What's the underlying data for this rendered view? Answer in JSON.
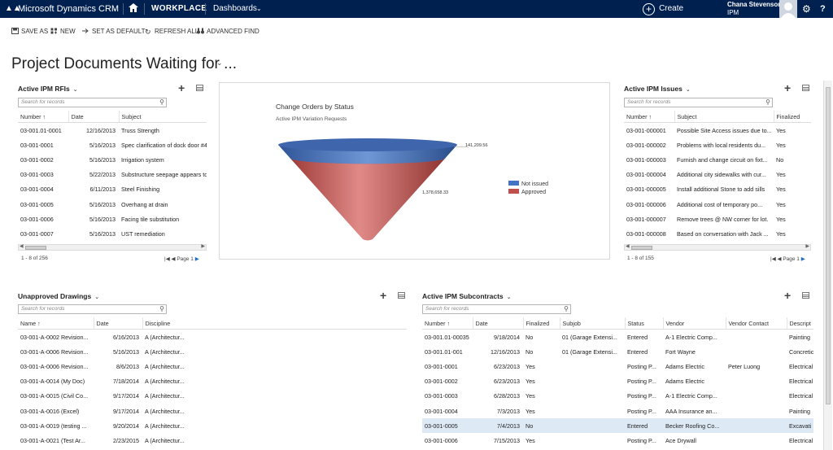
{
  "nav": {
    "app_name": "Microsoft Dynamics CRM",
    "workplace": "WORKPLACE",
    "area": "Dashboards",
    "create": "Create",
    "user_name": "Chana Stevenson",
    "user_org": "IPM",
    "help": "?"
  },
  "commands": {
    "save_as": "SAVE AS",
    "new": "NEW",
    "set_default": "SET AS DEFAULT",
    "refresh_all": "REFRESH ALL",
    "advanced_find": "ADVANCED FIND"
  },
  "page_title": "Project Documents Waiting for ...",
  "search_placeholder": "Search for records",
  "rfis": {
    "title": "Active IPM RFIs",
    "columns": [
      "Number ↑",
      "Date",
      "Subject"
    ],
    "rows": [
      [
        "03-001.01-0001",
        "12/16/2013",
        "Truss Strength"
      ],
      [
        "03-001-0001",
        "5/16/2013",
        "Spec clarification of dock door #4"
      ],
      [
        "03-001-0002",
        "5/16/2013",
        "Irrigation system"
      ],
      [
        "03-001-0003",
        "5/22/2013",
        "Substructure seepage appears to"
      ],
      [
        "03-001-0004",
        "6/11/2013",
        "Steel Finishing"
      ],
      [
        "03-001-0005",
        "5/16/2013",
        "Overhang at drain"
      ],
      [
        "03-001-0006",
        "5/16/2013",
        "Facing tile substitution"
      ],
      [
        "03-001-0007",
        "5/16/2013",
        "UST remediation"
      ]
    ],
    "footer": "1 - 8 of 256",
    "page": "Page 1"
  },
  "chart": {
    "title": "Change Orders by Status",
    "subtitle": "Active IPM Variation Requests",
    "label_top": "141,209.56",
    "label_main": "1,378,658.33",
    "legend": [
      {
        "name": "Not issued",
        "color": "#4472c4"
      },
      {
        "name": "Approved",
        "color": "#c0504d"
      }
    ]
  },
  "chart_data": {
    "type": "funnel",
    "title": "Change Orders by Status",
    "subtitle": "Active IPM Variation Requests",
    "series": [
      {
        "name": "Not issued",
        "value": 141209.56
      },
      {
        "name": "Approved",
        "value": 1378658.33
      }
    ],
    "legend_position": "right"
  },
  "issues": {
    "title": "Active IPM Issues",
    "columns": [
      "Number ↑",
      "Subject",
      "Finalized"
    ],
    "rows": [
      [
        "03-001-000001",
        "Possible Site Access issues due to...",
        "Yes"
      ],
      [
        "03-001-000002",
        "Problems with local residents du...",
        "Yes"
      ],
      [
        "03-001-000003",
        "Furnish and change circuit on fixt...",
        "No"
      ],
      [
        "03-001-000004",
        "Additional city sidewalks with cur...",
        "Yes"
      ],
      [
        "03-001-000005",
        "Install additional Stone to add sills",
        "Yes"
      ],
      [
        "03-001-000006",
        "Additional cost of temporary po...",
        "Yes"
      ],
      [
        "03-001-000007",
        "Remove trees @ NW corner for lot.",
        "Yes"
      ],
      [
        "03-001-000008",
        "Based on conversation with Jack ...",
        "Yes"
      ]
    ],
    "footer": "1 - 8 of 155",
    "page": "Page 1"
  },
  "drawings": {
    "title": "Unapproved Drawings",
    "columns": [
      "Name ↑",
      "Date",
      "Discipline"
    ],
    "rows": [
      [
        "03-001-A-0002 Revision...",
        "6/16/2013",
        "A (Architectur..."
      ],
      [
        "03-001-A-0006 Revision...",
        "5/16/2013",
        "A (Architectur..."
      ],
      [
        "03-001-A-0006 Revision...",
        "8/6/2013",
        "A (Architectur..."
      ],
      [
        "03-001-A-0014 (My Doc)",
        "7/18/2014",
        "A (Architectur..."
      ],
      [
        "03-001-A-0015 (Civil Co...",
        "9/17/2014",
        "A (Architectur..."
      ],
      [
        "03-001-A-0016 (Excel)",
        "9/17/2014",
        "A (Architectur..."
      ],
      [
        "03-001-A-0019 (testing ...",
        "9/20/2014",
        "A (Architectur..."
      ],
      [
        "03-001-A-0021 (Test Ar...",
        "2/23/2015",
        "A (Architectur..."
      ]
    ]
  },
  "subcontracts": {
    "title": "Active IPM Subcontracts",
    "columns": [
      "Number ↑",
      "Date",
      "Finalized",
      "Subjob",
      "Status",
      "Vendor",
      "Vendor Contact",
      "Descript"
    ],
    "rows": [
      [
        "03-001.01-00035",
        "9/18/2014",
        "No",
        "01 (Garage Extensi...",
        "Entered",
        "A-1 Electric Comp...",
        "",
        "Painting"
      ],
      [
        "03-001.01-001",
        "12/16/2013",
        "No",
        "01 (Garage Extensi...",
        "Entered",
        "Fort Wayne",
        "",
        "Concretic"
      ],
      [
        "03-001-0001",
        "6/23/2013",
        "Yes",
        "",
        "Posting P...",
        "Adams Electric",
        "Peter Luong",
        "Electrical"
      ],
      [
        "03-001-0002",
        "6/23/2013",
        "Yes",
        "",
        "Posting P...",
        "Adams Electric",
        "",
        "Electrical"
      ],
      [
        "03-001-0003",
        "6/28/2013",
        "Yes",
        "",
        "Posting P...",
        "A-1 Electric Comp...",
        "",
        "Electrical"
      ],
      [
        "03-001-0004",
        "7/3/2013",
        "Yes",
        "",
        "Posting P...",
        "AAA Insurance an...",
        "",
        "Painting"
      ],
      [
        "03-001-0005",
        "7/4/2013",
        "No",
        "",
        "Entered",
        "Becker Roofing Co...",
        "",
        "Excavati"
      ],
      [
        "03-001-0006",
        "7/15/2013",
        "Yes",
        "",
        "Posting P...",
        "Ace Drywall",
        "",
        "Electrical"
      ]
    ],
    "selected_row": 6
  }
}
